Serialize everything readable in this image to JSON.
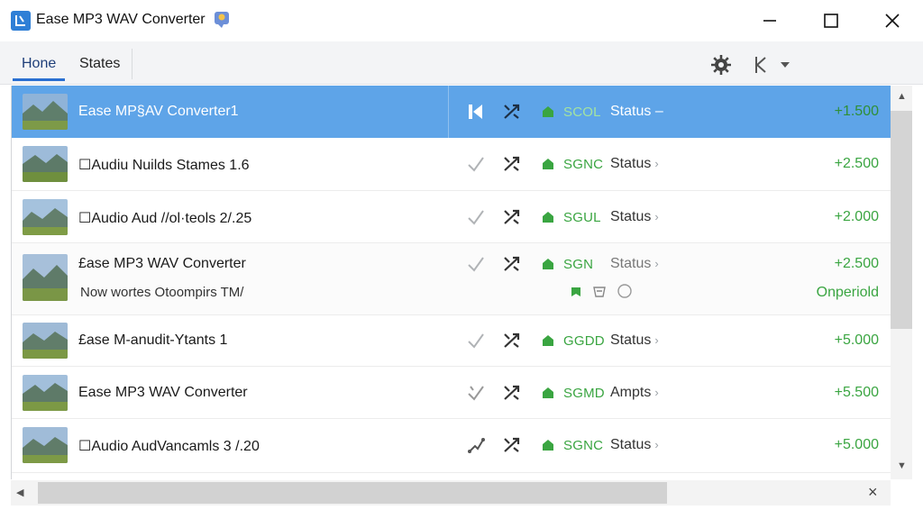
{
  "window": {
    "title": "Ease MP3 WAV Converter",
    "controls": {
      "minimize": "minimize",
      "maximize": "maximize",
      "close": "close"
    }
  },
  "tabs": [
    {
      "label": "Hone",
      "active": true
    },
    {
      "label": "States",
      "active": false
    }
  ],
  "colors": {
    "accent": "#2a6fd1",
    "selected_row": "#5ea4e8",
    "green": "#3aa541"
  },
  "rows": [
    {
      "name": "Ease MP§AV Converter1",
      "code": "SCOL",
      "status": "Status",
      "status_suffix": "–",
      "amount": "+1.500",
      "selected": true
    },
    {
      "name": "☐Audiu Nuilds Stames 1.6",
      "code": "SGNC",
      "status": "Status",
      "amount": "+2.500"
    },
    {
      "name": "☐Audio Aud //ol·teols 2/.25",
      "code": "SGUL",
      "status": "Status",
      "amount": "+2.000"
    },
    {
      "name": "£ase MP3 WAV Converter",
      "sub": "Now wortes Otoompirs TM/",
      "code": "SGN",
      "status": "Status",
      "amount": "+2.500",
      "sub_amount": "Onperiold"
    },
    {
      "name": "£ase M-anudit-Ytants 1",
      "code": "GGDD",
      "status": "Status",
      "amount": "+5.000"
    },
    {
      "name": "Ease MP3 WAV Converter",
      "code": "SGMD",
      "status": "Ampts",
      "amount": "+5.500"
    },
    {
      "name": "☐Audio AudVancamls 3 /.20",
      "code": "SGNC",
      "status": "Status",
      "amount": "+5.000"
    }
  ],
  "hscroll": {
    "close_label": "×"
  }
}
